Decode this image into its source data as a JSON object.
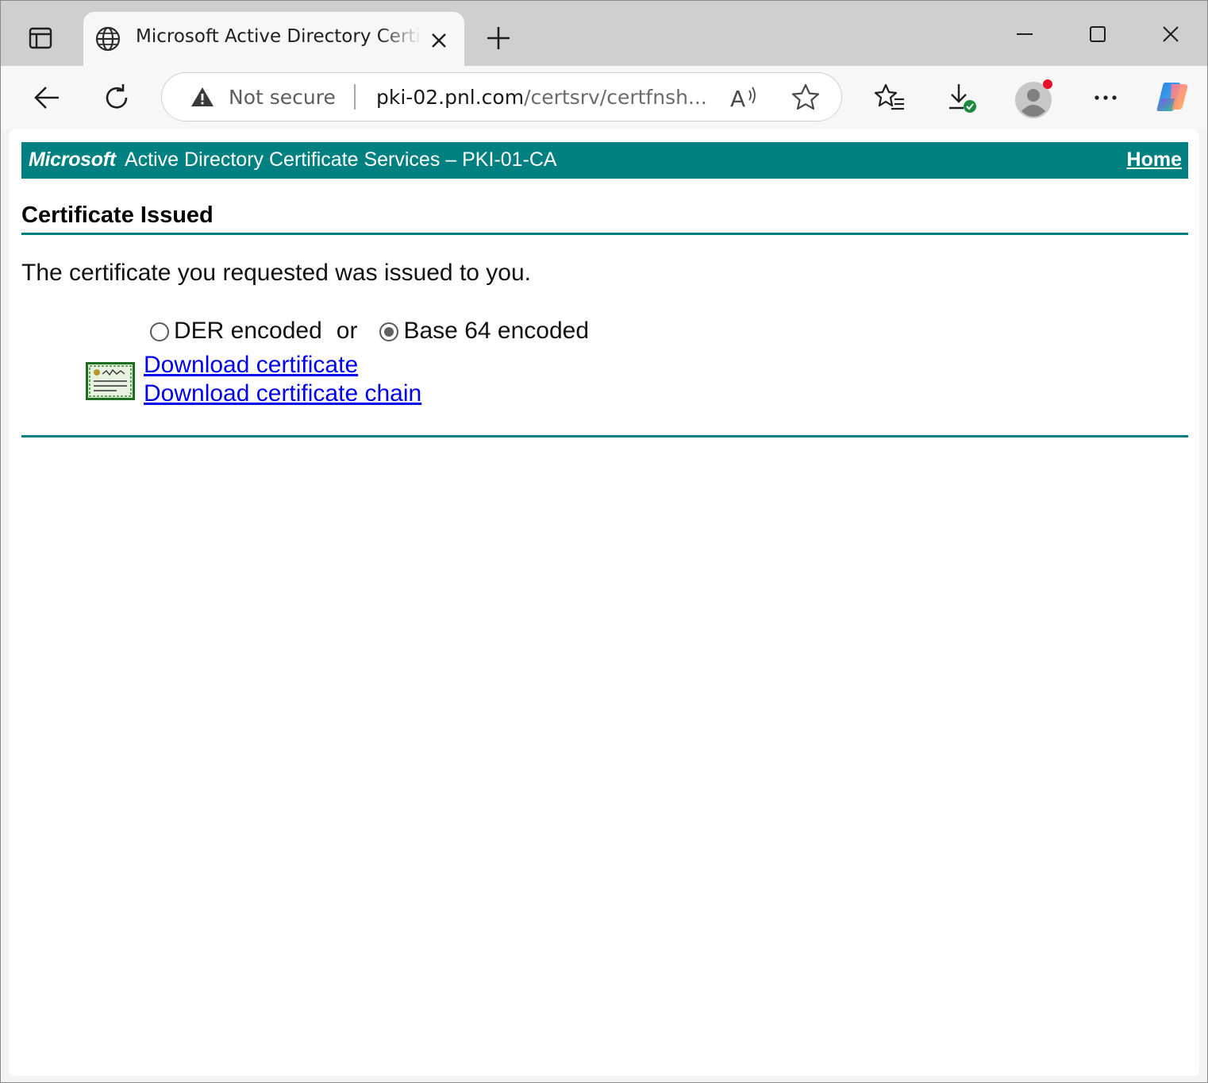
{
  "browser": {
    "tab": {
      "title": "Microsoft Active Directory Certificate Services",
      "favicon": "globe-icon"
    },
    "address_bar": {
      "security_text": "Not secure",
      "url_host": "pki-02.pnl.com",
      "url_path": "/certsrv/certfnsh..."
    },
    "toolbar_icons": [
      "back-icon",
      "refresh-icon",
      "read-aloud-icon",
      "favorite-star-icon",
      "favorites-icon",
      "downloads-icon",
      "profile-icon",
      "more-icon",
      "copilot-icon"
    ]
  },
  "page": {
    "banner": {
      "brand": "Microsoft",
      "service": "Active Directory Certificate Services  –  PKI-01-CA",
      "home_link": "Home",
      "color": "#008080"
    },
    "heading": "Certificate Issued",
    "message": "The certificate you requested was issued to you.",
    "encoding": {
      "options": [
        "DER encoded",
        "Base 64 encoded"
      ],
      "separator": "or",
      "selected": "Base 64 encoded"
    },
    "links": {
      "download_certificate": "Download certificate",
      "download_chain": "Download certificate chain"
    }
  }
}
